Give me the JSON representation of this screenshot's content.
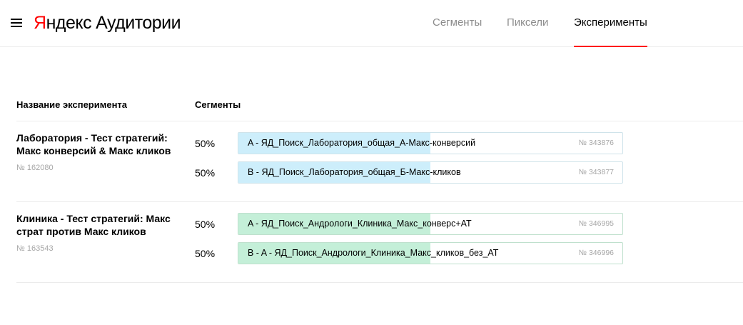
{
  "header": {
    "logo_brand_first": "Я",
    "logo_brand_rest": "ндекс",
    "logo_product": "Аудитории",
    "nav": {
      "segments": "Сегменты",
      "pixels": "Пиксели",
      "experiments": "Эксперименты"
    },
    "active_nav": "experiments"
  },
  "table": {
    "columns": {
      "name": "Название эксперимента",
      "segments": "Сегменты"
    },
    "experiments": [
      {
        "name": "Лаборатория - Тест стратегий: Макс конверсий & Макс кликов",
        "id": "№ 162080",
        "segments": [
          {
            "percent": "50%",
            "label": "A - ЯД_Поиск_Лаборатория_общая_А-Макс-конверсий",
            "number": "№ 343876",
            "share": 0.5
          },
          {
            "percent": "50%",
            "label": "B - ЯД_Поиск_Лаборатория_общая_Б-Макс-кликов",
            "number": "№ 343877",
            "share": 0.5
          }
        ]
      },
      {
        "name": "Клиника - Тест стратегий: Макс страт против Макс кликов",
        "id": "№ 163543",
        "segments": [
          {
            "percent": "50%",
            "label": "A - ЯД_Поиск_Андрологи_Клиника_Макс_конверс+АТ",
            "number": "№ 346995",
            "share": 0.5
          },
          {
            "percent": "50%",
            "label": "B - A - ЯД_Поиск_Андрологи_Клиника_Макс_кликов_без_АТ",
            "number": "№ 346996",
            "share": 0.5
          }
        ]
      }
    ]
  },
  "colors": {
    "accent": "#ff0000",
    "segment_fill_experiment_1": "#cdeefb",
    "segment_fill_experiment_2": "#c4efd8",
    "muted_text": "#a6a6a6"
  }
}
